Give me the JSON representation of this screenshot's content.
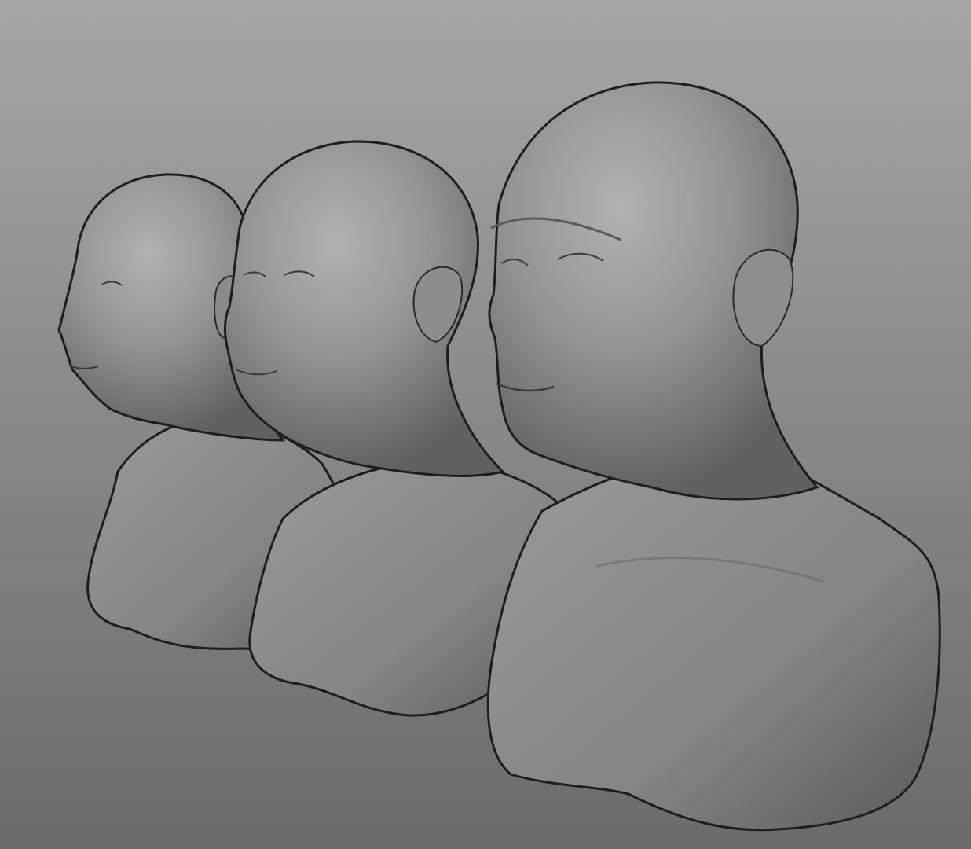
{
  "scene": {
    "background_top": "#a6a6a6",
    "background_bottom": "#6b6b6b",
    "surface_color": "#8c8c8c",
    "outline_color": "#1e1e1e",
    "busts": [
      {
        "name": "bust-small"
      },
      {
        "name": "bust-medium"
      },
      {
        "name": "bust-large"
      }
    ]
  }
}
